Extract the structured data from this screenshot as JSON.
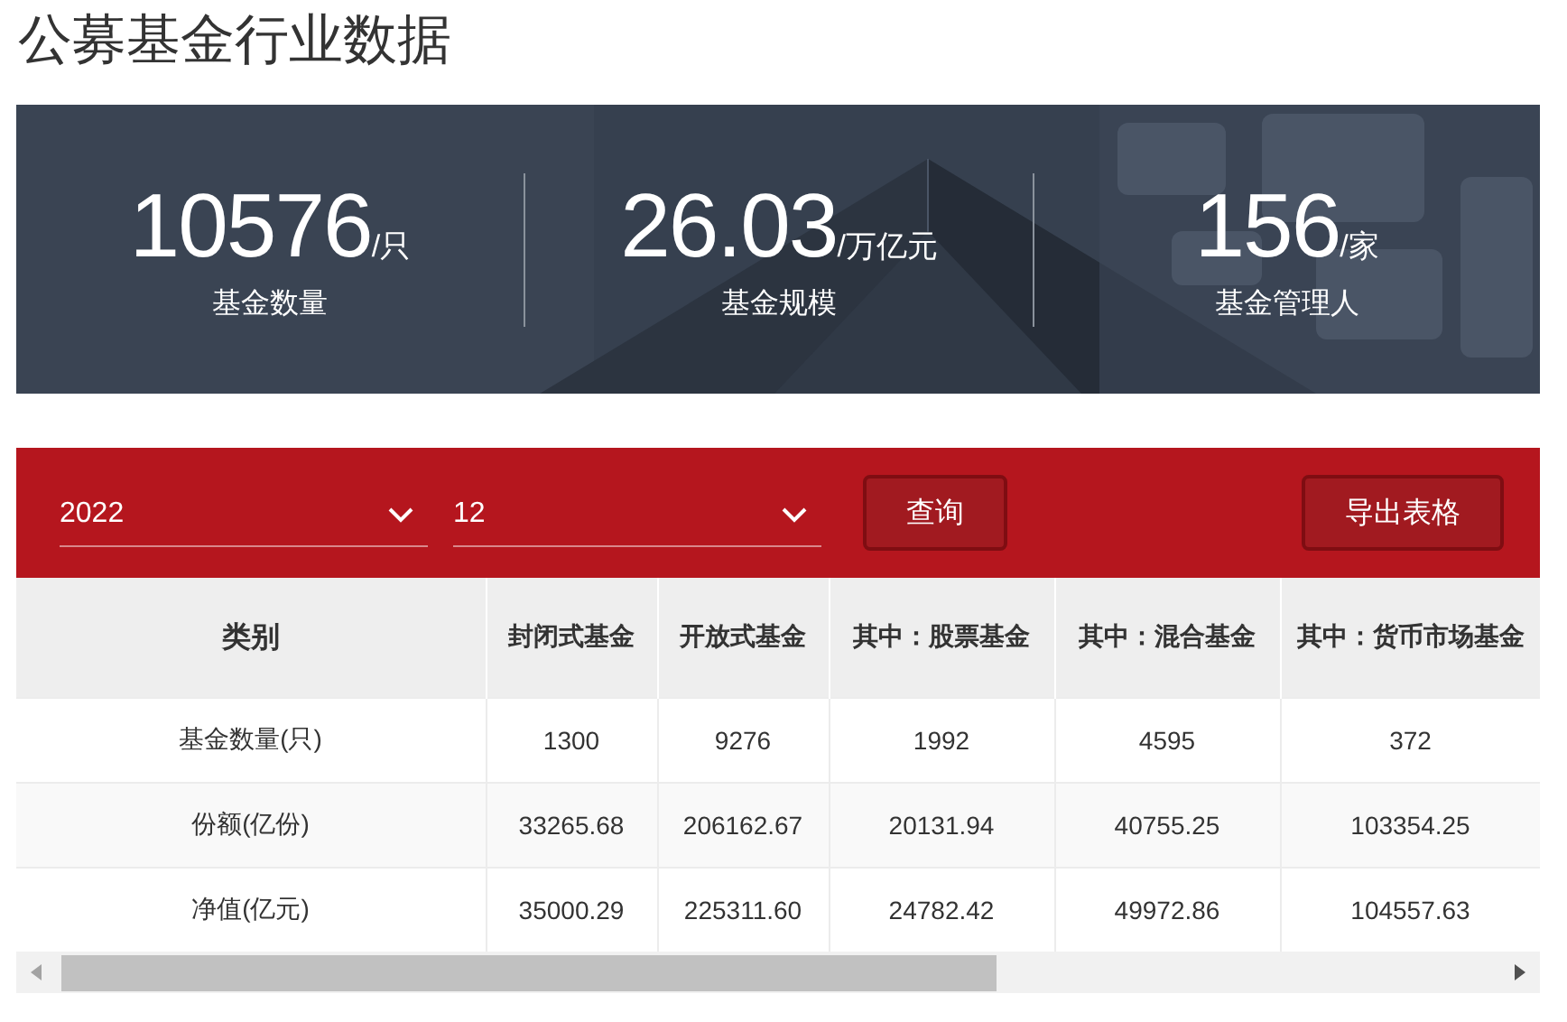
{
  "page_title": "公募基金行业数据",
  "stats": [
    {
      "value": "10576",
      "unit": "/只",
      "label": "基金数量"
    },
    {
      "value": "26.03",
      "unit": "/万亿元",
      "label": "基金规模"
    },
    {
      "value": "156",
      "unit": "/家",
      "label": "基金管理人"
    }
  ],
  "filters": [
    {
      "value": "2022"
    },
    {
      "value": "12"
    }
  ],
  "buttons": [
    "查询",
    "导出表格"
  ],
  "table": {
    "columns": [
      "类别",
      "封闭式基金",
      "开放式基金",
      "其中：股票基金",
      "其中：混合基金",
      "其中：货币市场基金"
    ],
    "rows": [
      [
        "基金数量(只)",
        "1300",
        "9276",
        "1992",
        "4595",
        "372"
      ],
      [
        "份额(亿份)",
        "33265.68",
        "206162.67",
        "20131.94",
        "40755.25",
        "103354.25"
      ],
      [
        "净值(亿元)",
        "35000.29",
        "225311.60",
        "24782.42",
        "49972.86",
        "104557.63"
      ]
    ]
  }
}
